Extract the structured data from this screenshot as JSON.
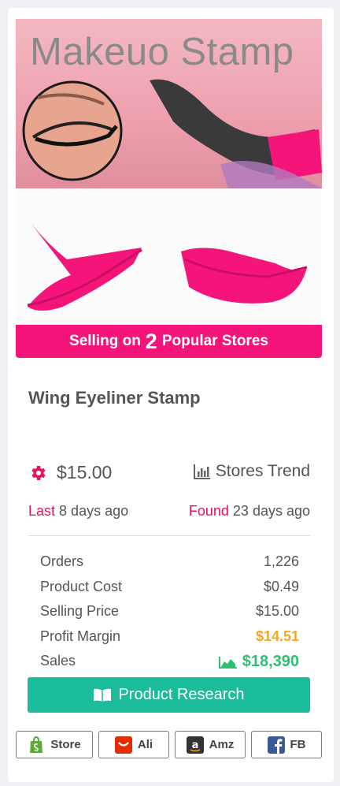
{
  "product": {
    "image_title": "Makeuo Stamp",
    "banner_prefix": "Selling on",
    "banner_count": "2",
    "banner_suffix": "Popular Stores",
    "title": "Wing Eyeliner Stamp",
    "price": "$15.00",
    "trend_label": "Stores Trend",
    "last_label": "Last",
    "last_value": "8 days ago",
    "found_label": "Found",
    "found_value": "23 days ago"
  },
  "stats": [
    {
      "label": "Orders",
      "value": "1,226"
    },
    {
      "label": "Product Cost",
      "value": "$0.49"
    },
    {
      "label": "Selling Price",
      "value": "$15.00"
    },
    {
      "label": "Profit Margin",
      "value": "$14.51"
    },
    {
      "label": "Sales",
      "value": "$18,390"
    }
  ],
  "actions": {
    "research_label": "Product Research",
    "store_label": "Store",
    "ali_label": "Ali",
    "amz_label": "Amz",
    "fb_label": "FB"
  },
  "colors": {
    "accent_pink": "#f5157a",
    "teal": "#1abc9c",
    "orange": "#f5a623",
    "green": "#2ebf72"
  },
  "icons": [
    "gear-icon",
    "bar-chart-icon",
    "area-chart-icon",
    "book-icon",
    "shopify-bag-icon",
    "aliexpress-icon",
    "amazon-icon",
    "facebook-icon"
  ]
}
